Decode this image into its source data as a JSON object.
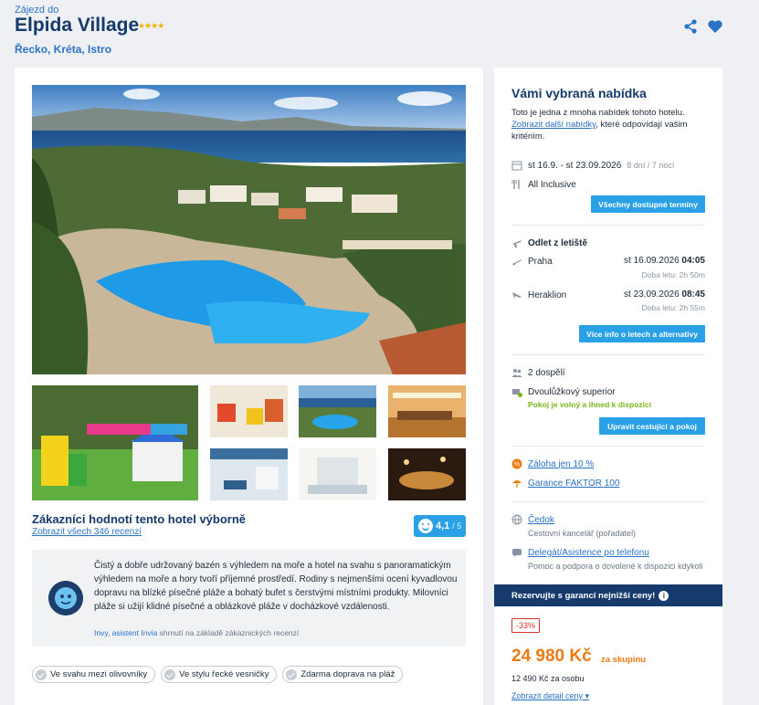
{
  "header": {
    "eyebrow": "Zájezd do",
    "hotel_name": "Elpida Village",
    "stars": "★★★★",
    "location": "Řecko, Kréta, Istro"
  },
  "gallery": {
    "hero_alt": "Pohled na hotel a bazén s výhledem na moře",
    "thumbs": [
      "dětské hřiště",
      "restaurace",
      "bazén",
      "jídelna",
      "interiér",
      "pokoj",
      "noční terasa"
    ]
  },
  "rating": {
    "title": "Zákazníci hodnotí tento hotel výborně",
    "link": "Zobrazit všech 346 recenzí",
    "score": "4,1",
    "of": "/ 5"
  },
  "review": {
    "text": "Čistý a dobře udržovaný bazén s výhledem na moře a hotel na svahu s panoramatickým výhledem na moře a hory tvoří příjemné prostředí. Rodiny s nejmenšími ocení kyvadlovou dopravu na blízké písečné pláže a bohatý bufet s čerstvými místními produkty. Milovníci pláže si užijí klidné písečné a oblázkové pláže v docházkové vzdálenosti.",
    "sig_author": "Invy, asistent Invia",
    "sig_rest": " shrnutí na základě zákaznických recenzí"
  },
  "chips": [
    "Ve svahu mezi olivovníky",
    "Ve stylu řecké vesničky",
    "Zdarma doprava na pláž"
  ],
  "offer": {
    "title": "Vámi vybraná nabídka",
    "desc_1": "Toto je jedna z mnoha nabídek tohoto hotelu.",
    "desc_link": "Zobrazit další nabídky",
    "desc_2": ", které odpovídají vašim kritériím.",
    "dates": "st 16.9. - st 23.09.2026",
    "duration": "8 dní / 7 nocí",
    "board": "All Inclusive",
    "btn_dates": "Všechny dostupné termíny",
    "departure_label": "Odlet z letiště",
    "out_city": "Praha",
    "out_time": "st 16.09.2026",
    "out_hour": "04:05",
    "out_dur": "Doba letu: 2h 50m",
    "back_city": "Heraklion",
    "back_time": "st 23.09.2026",
    "back_hour": "08:45",
    "back_dur": "Doba letu: 2h 55m",
    "btn_flights": "Více info o letech a alternativy",
    "travelers": "2 dospělí",
    "room": "Dvoulůžkový superior",
    "room_status": "Pokoj je volný a ihned k dispozici",
    "btn_travelers": "Upravit cestující a pokoj",
    "deposit": "Záloha jen 10 %",
    "guarantee": "Garance FAKTOR 100",
    "agency": "Čedok",
    "agency_sub": "Cestovní kancelář (pořadatel)",
    "delegate": "Delegát/Asistence po telefonu",
    "delegate_sub": "Pomoc a podpora o dovolené k dispozici kdykoli",
    "banner": "Rezervujte s garancí nejnižší ceny!",
    "discount": "-33%",
    "price": "24 980 Kč",
    "price_sfx": "za skupinu",
    "per_person_price": "12 490 Kč",
    "per_person_sfx": " za osobu",
    "detail_link": "Zobrazit detail ceny"
  },
  "colors": {
    "brand": "#153a6b",
    "accent": "#2aa0e6",
    "price": "#ee7a14",
    "available": "#7ab51d"
  }
}
